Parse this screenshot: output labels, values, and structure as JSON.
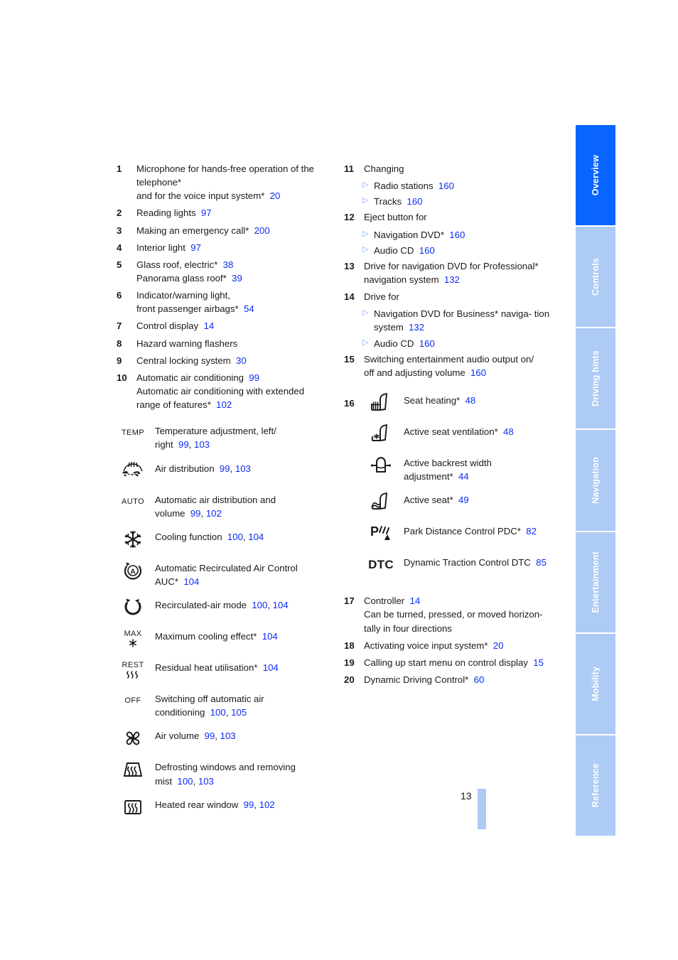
{
  "page": {
    "number": "13",
    "marker_color": "#aecbf5"
  },
  "tabs": [
    {
      "label": "Overview",
      "active": true
    },
    {
      "label": "Controls",
      "active": false
    },
    {
      "label": "Driving hints",
      "active": false
    },
    {
      "label": "Navigation",
      "active": false
    },
    {
      "label": "Entertainment",
      "active": false
    },
    {
      "label": "Mobility",
      "active": false
    },
    {
      "label": "Reference",
      "active": false
    }
  ],
  "colors": {
    "tab_active": "#0a64ff",
    "tab_inactive": "#aecbf5",
    "page_ref": "#0a2bf5",
    "bullet": "#7aa9f0"
  },
  "left_column": {
    "entries": [
      {
        "num": "1",
        "lines": [
          "Microphone for hands-free operation of the",
          "telephone*",
          "and for the voice input system*"
        ],
        "ref": "20"
      },
      {
        "num": "2",
        "lines": [
          "Reading lights"
        ],
        "ref": "97"
      },
      {
        "num": "3",
        "lines": [
          "Making an emergency call*"
        ],
        "ref": "200"
      },
      {
        "num": "4",
        "lines": [
          "Interior light"
        ],
        "ref": "97"
      },
      {
        "num": "5",
        "lines": [
          "Glass roof, electric*"
        ],
        "ref": "38",
        "second_line": "Panorama glass roof*",
        "second_ref": "39"
      },
      {
        "num": "6",
        "lines": [
          "Indicator/warning light,",
          "front passenger airbags*"
        ],
        "ref": "54"
      },
      {
        "num": "7",
        "lines": [
          "Control display"
        ],
        "ref": "14"
      },
      {
        "num": "8",
        "lines": [
          "Hazard warning flashers"
        ],
        "ref": ""
      },
      {
        "num": "9",
        "lines": [
          "Central locking system"
        ],
        "ref": "30"
      },
      {
        "num": "10",
        "lines": [
          "Automatic air conditioning"
        ],
        "ref": "99",
        "extra_lines": [
          "Automatic air conditioning with extended",
          "range of features*"
        ],
        "extra_ref": "102"
      }
    ],
    "icons": [
      {
        "icon": "temp-icon",
        "glyph_text": "TEMP",
        "lines": [
          "Temperature adjustment, left/",
          "right"
        ],
        "refs": [
          "99",
          "103"
        ]
      },
      {
        "icon": "air-distribution-icon",
        "glyph_text": "",
        "lines": [
          "Air distribution"
        ],
        "refs": [
          "99",
          "103"
        ]
      },
      {
        "icon": "auto-icon",
        "glyph_text": "AUTO",
        "lines": [
          "Automatic air distribution and",
          "volume"
        ],
        "refs": [
          "99",
          "102"
        ]
      },
      {
        "icon": "snowflake-cooling-icon",
        "glyph_text": "",
        "lines": [
          "Cooling function"
        ],
        "refs": [
          "100",
          "104"
        ]
      },
      {
        "icon": "auc-recirculation-icon",
        "glyph_text": "",
        "lines": [
          "Automatic Recirculated Air Control",
          "AUC*"
        ],
        "refs": [
          "104"
        ]
      },
      {
        "icon": "recirculated-air-icon",
        "glyph_text": "",
        "lines": [
          "Recirculated-air mode"
        ],
        "refs": [
          "100",
          "104"
        ]
      },
      {
        "icon": "max-cooling-icon",
        "glyph_text": "MAX",
        "lines": [
          "Maximum cooling effect*"
        ],
        "refs": [
          "104"
        ]
      },
      {
        "icon": "rest-heat-icon",
        "glyph_text": "REST",
        "lines": [
          "Residual heat utilisation*"
        ],
        "refs": [
          "104"
        ]
      },
      {
        "icon": "off-icon",
        "glyph_text": "OFF",
        "lines": [
          "Switching off automatic air",
          "conditioning"
        ],
        "refs": [
          "100",
          "105"
        ]
      },
      {
        "icon": "fan-air-volume-icon",
        "glyph_text": "",
        "lines": [
          "Air volume"
        ],
        "refs": [
          "99",
          "103"
        ]
      },
      {
        "icon": "defrost-windscreen-icon",
        "glyph_text": "",
        "lines": [
          "Defrosting windows and removing",
          "mist"
        ],
        "refs": [
          "100",
          "103"
        ]
      },
      {
        "icon": "heated-rear-window-icon",
        "glyph_text": "",
        "lines": [
          "Heated rear window"
        ],
        "refs": [
          "99",
          "102"
        ]
      }
    ]
  },
  "right_column": {
    "entry_11": {
      "num": "11",
      "title": "Changing",
      "subs": [
        {
          "text": "Radio stations",
          "ref": "160"
        },
        {
          "text": "Tracks",
          "ref": "160"
        }
      ]
    },
    "entry_12": {
      "num": "12",
      "title": "Eject button for",
      "subs": [
        {
          "text": "Navigation DVD*",
          "ref": "160"
        },
        {
          "text": "Audio CD",
          "ref": "160"
        }
      ]
    },
    "entry_13": {
      "num": "13",
      "lines": [
        "Drive for navigation DVD for Professional*",
        "navigation system"
      ],
      "ref": "132"
    },
    "entry_14": {
      "num": "14",
      "title": "Drive for",
      "subs": [
        {
          "text": "Navigation DVD for Business* naviga-",
          "text2": "tion system",
          "ref": "132"
        },
        {
          "text": "Audio CD",
          "ref": "160"
        }
      ]
    },
    "entry_15": {
      "num": "15",
      "lines": [
        "Switching entertainment audio output on/",
        "off and adjusting volume"
      ],
      "ref": "160"
    },
    "entry_16": {
      "num": "16",
      "icons": [
        {
          "icon": "seat-heating-icon",
          "glyph_text": "",
          "lines": [
            "Seat heating*"
          ],
          "refs": [
            "48"
          ]
        },
        {
          "icon": "seat-ventilation-icon",
          "glyph_text": "",
          "lines": [
            "Active seat ventilation*"
          ],
          "refs": [
            "48"
          ]
        },
        {
          "icon": "backrest-width-icon",
          "glyph_text": "",
          "lines": [
            "Active backrest width",
            "adjustment*"
          ],
          "refs": [
            "44"
          ]
        },
        {
          "icon": "active-seat-icon",
          "glyph_text": "",
          "lines": [
            "Active seat*"
          ],
          "refs": [
            "49"
          ]
        },
        {
          "icon": "pdc-icon",
          "glyph_text": "",
          "lines": [
            "Park Distance Control PDC*"
          ],
          "refs": [
            "82"
          ]
        },
        {
          "icon": "dtc-icon",
          "glyph_text": "DTC",
          "lines": [
            "Dynamic Traction Control DTC"
          ],
          "refs": [
            "85"
          ]
        }
      ]
    },
    "entry_17": {
      "num": "17",
      "lines": [
        "Controller"
      ],
      "ref": "14",
      "extra_lines": [
        "Can be turned, pressed, or moved horizon-",
        "tally in four directions"
      ]
    },
    "entry_18": {
      "num": "18",
      "lines": [
        "Activating voice input system*"
      ],
      "ref": "20"
    },
    "entry_19": {
      "num": "19",
      "lines": [
        "Calling up start menu on control display"
      ],
      "ref": "15"
    },
    "entry_20": {
      "num": "20",
      "lines": [
        "Dynamic Driving Control*"
      ],
      "ref": "60"
    }
  }
}
